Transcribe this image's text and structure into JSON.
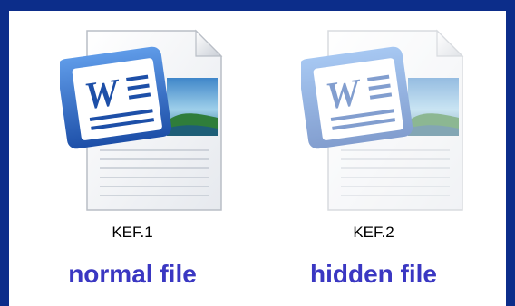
{
  "accent_color": "#3a37c2",
  "border_color": "#0c2d8a",
  "files": [
    {
      "name": "KEF.1",
      "caption": "normal file",
      "icon": "word-document-icon",
      "hidden": false
    },
    {
      "name": "KEF.2",
      "caption": "hidden file",
      "icon": "word-document-icon",
      "hidden": true
    }
  ]
}
